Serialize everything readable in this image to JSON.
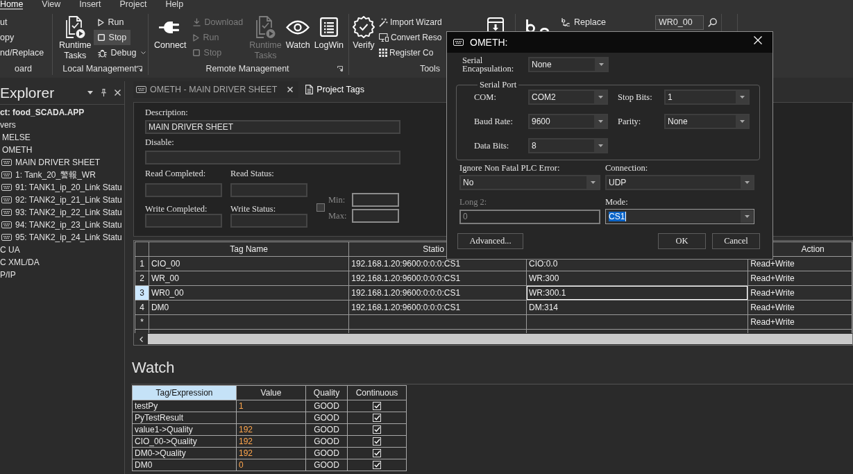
{
  "menu_tabs": [
    {
      "label": "Home",
      "selected": true
    },
    {
      "label": "View",
      "selected": false
    },
    {
      "label": "Insert",
      "selected": false
    },
    {
      "label": "Project",
      "selected": false
    },
    {
      "label": "Help",
      "selected": false
    }
  ],
  "ribbon": {
    "clipboard": {
      "items": [
        "ut",
        "opy",
        "nd/Replace"
      ],
      "label": "oard"
    },
    "local_management": {
      "runtime_tasks": "Runtime Tasks",
      "small_buttons": [
        {
          "kind": "run",
          "label": "Run",
          "pressed": false
        },
        {
          "kind": "stop",
          "label": "Stop",
          "pressed": true
        },
        {
          "kind": "debug",
          "label": "Debug",
          "pressed": false
        }
      ],
      "label": "Local Management"
    },
    "remote_management": {
      "connect": "Connect",
      "transfer_buttons": [
        {
          "kind": "download",
          "label": "Download",
          "disabled": true
        },
        {
          "kind": "run",
          "label": "Run",
          "disabled": true
        },
        {
          "kind": "stop",
          "label": "Stop",
          "disabled": true
        }
      ],
      "runtime_tasks": {
        "label": "Runtime Tasks",
        "disabled": true
      },
      "watch": "Watch",
      "logwin": "LogWin",
      "label": "Remote Management"
    },
    "tools": {
      "verify": "Verify",
      "small_buttons": [
        {
          "kind": "wizard",
          "label": "Import Wizard"
        },
        {
          "kind": "convert",
          "label": "Convert Reso"
        },
        {
          "kind": "register",
          "label": "Register Co"
        }
      ],
      "label": "Tools"
    },
    "find": {
      "replace": "Replace",
      "search": {
        "value": "WR0_00"
      }
    }
  },
  "explorer": {
    "title": "Explorer",
    "tree": [
      {
        "label": "ct: food_SCADA.APP",
        "children": [
          {
            "label": "vers",
            "children": [
              {
                "label": "MELSE"
              },
              {
                "label": "OMETH",
                "children": [
                  {
                    "label": "MAIN DRIVER SHEET"
                  },
                  {
                    "label": "1: Tank_20_警報_WR"
                  },
                  {
                    "label": "91: TANK1_ip_20_Link Statu"
                  },
                  {
                    "label": "92: TANK2_ip_21_Link Statu"
                  },
                  {
                    "label": "93: TANK2_ip_22_Link Statu"
                  },
                  {
                    "label": "94: TANK2_ip_23_Link Statu"
                  },
                  {
                    "label": "95: TANK2_ip_24_Link Statu"
                  }
                ]
              }
            ]
          },
          {
            "label": "C UA"
          },
          {
            "label": "C XML/DA"
          },
          {
            "label": "P/IP"
          }
        ]
      }
    ]
  },
  "document_tabs": [
    {
      "label": "OMETH - MAIN DRIVER SHEET",
      "selected": true
    },
    {
      "label": "Project Tags",
      "selected": false
    }
  ],
  "driver_sheet": {
    "description": {
      "label": "Description:",
      "value": "MAIN DRIVER SHEET"
    },
    "disable": {
      "label": "Disable:"
    },
    "read_completed": {
      "label": "Read Completed:"
    },
    "read_status": {
      "label": "Read Status:"
    },
    "write_completed": {
      "label": "Write Completed:"
    },
    "write_status": {
      "label": "Write Status:"
    },
    "range": {
      "checked": false,
      "min_label": "Min:",
      "max_label": "Max:"
    }
  },
  "tag_table": {
    "header": {
      "tag_name": "Tag Name",
      "station": "Statio",
      "action": "Action"
    },
    "rows": [
      {
        "number": "1",
        "tag_name": "CIO_00",
        "station": "192.168.1.20:9600:0:0:0:CS1",
        "column_3": "CIO:0.0",
        "action": "Read+Write",
        "selected": false
      },
      {
        "number": "2",
        "tag_name": "WR_00",
        "station": "192.168.1.20:9600:0:0:0:CS1",
        "column_3": "WR:300",
        "action": "Read+Write",
        "selected": false
      },
      {
        "number": "3",
        "tag_name": "WR0_00",
        "station": "192.168.1.20:9600:0:0:0:CS1",
        "column_3": "WR:300.1",
        "action": "Read+Write",
        "selected": true
      },
      {
        "number": "4",
        "tag_name": "DM0",
        "station": "192.168.1.20:9600:0:0:0:CS1",
        "column_3": "DM:314",
        "action": "Read+Write",
        "selected": false
      },
      {
        "number": "*",
        "action": "Read+Write",
        "selected": false
      }
    ]
  },
  "watch": {
    "title": "Watch",
    "columns": [
      {
        "label": "Tag/Expression",
        "selected": true
      },
      {
        "label": "Value",
        "selected": false
      },
      {
        "label": "Quality",
        "selected": false
      },
      {
        "label": "Continuous",
        "selected": false
      }
    ],
    "rows": [
      {
        "expression": "testPy",
        "value": "1",
        "quality": "GOOD",
        "continuous": true
      },
      {
        "expression": "PyTestResult",
        "quality": "GOOD",
        "continuous": true
      },
      {
        "expression": "value1->Quality",
        "value": "192",
        "quality": "GOOD",
        "continuous": true
      },
      {
        "expression": "CIO_00->Quality",
        "value": "192",
        "quality": "GOOD",
        "continuous": true
      },
      {
        "expression": "DM0->Quality",
        "value": "192",
        "quality": "GOOD",
        "continuous": true
      },
      {
        "expression": "DM0",
        "value": "0",
        "quality": "GOOD",
        "continuous": true
      }
    ]
  },
  "dialog": {
    "title": "OMETH:",
    "serial_encapsulation": {
      "label": "Serial Encapsulation:",
      "value": "None"
    },
    "serial_port": {
      "title": "Serial Port",
      "com": {
        "label": "COM:",
        "value": "COM2"
      },
      "stop_bits": {
        "label": "Stop Bits:",
        "value": "1"
      },
      "baud_rate": {
        "label": "Baud Rate:",
        "value": "9600"
      },
      "parity": {
        "label": "Parity:",
        "value": "None"
      },
      "data_bits": {
        "label": "Data Bits:",
        "value": "8"
      }
    },
    "ignore_error": {
      "label": "Ignore Non Fatal PLC Error:",
      "value": "No"
    },
    "connection": {
      "label": "Connection:",
      "value": "UDP"
    },
    "long_2": {
      "label": "Long 2:",
      "value": "0",
      "disabled": true
    },
    "mode": {
      "label": "Mode:",
      "value": "CS1",
      "focused": true
    },
    "buttons": [
      {
        "label": "Advanced..."
      },
      {
        "label": "OK"
      },
      {
        "label": "Cancel"
      }
    ]
  }
}
